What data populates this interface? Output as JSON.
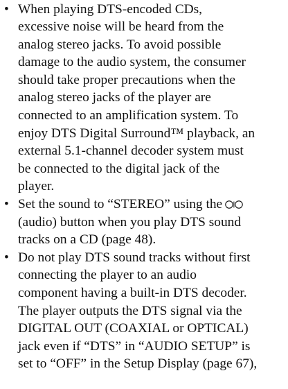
{
  "bullet_symbol": "•",
  "icons": {
    "audio": "audio-icon"
  },
  "document": {
    "bullets": [
      {
        "lines": [
          "When playing DTS-encoded CDs,",
          "excessive noise will be heard from the",
          "analog stereo jacks. To avoid possible",
          "damage to the audio system, the consumer",
          "should take proper precautions when the",
          "analog stereo jacks of the player are",
          "connected to an amplification system. To",
          "enjoy DTS Digital Surround™ playback, an",
          "external 5.1-channel decoder system must",
          "be connected to the digital jack of the",
          "player."
        ]
      },
      {
        "line1_before_icon": "Set the sound to “STEREO” using the",
        "lines_after_icon": [
          "(audio) button when you play DTS sound",
          "tracks on a CD (page 48)."
        ]
      },
      {
        "lines": [
          "Do not play DTS sound tracks without first",
          "connecting the player to an audio",
          "component having a built-in DTS decoder.",
          "The player outputs the DTS signal via the",
          "DIGITAL OUT (COAXIAL or OPTICAL)",
          "jack even if “DTS” in “AUDIO SETUP” is",
          "set to “OFF” in the Setup Display (page 67),"
        ]
      }
    ]
  }
}
